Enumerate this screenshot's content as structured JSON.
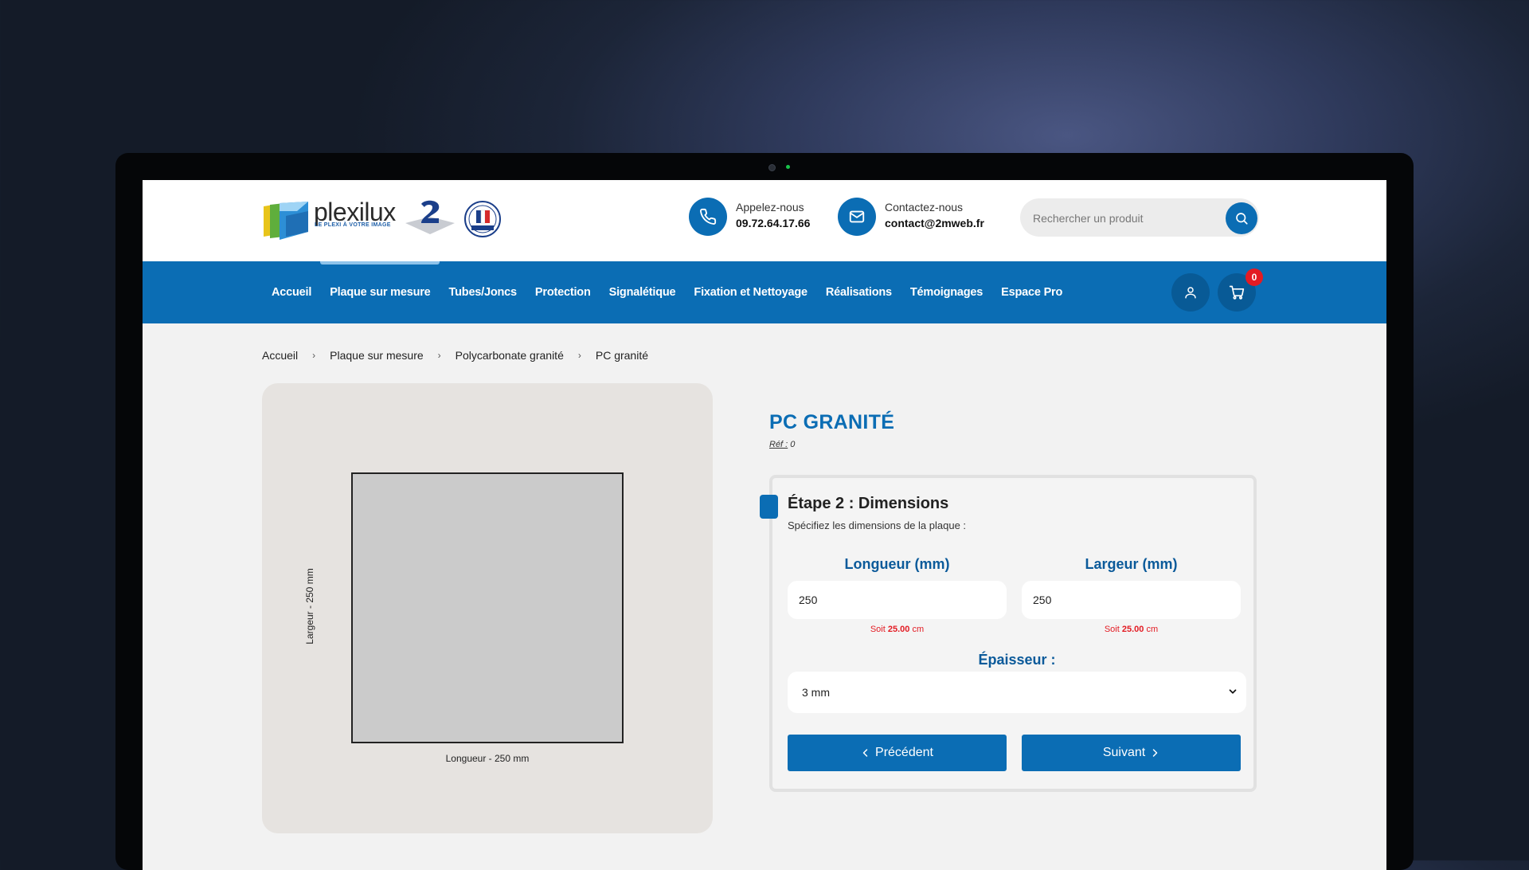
{
  "brand": {
    "name": "plexilux",
    "tagline": "LE PLEXI À VOTRE IMAGE",
    "accent_color": "#0b6db4"
  },
  "contact": {
    "phone_label": "Appelez-nous",
    "phone_value": "09.72.64.17.66",
    "email_label": "Contactez-nous",
    "email_value": "contact@2mweb.fr"
  },
  "search": {
    "placeholder": "Rechercher un produit"
  },
  "nav": {
    "items": [
      "Accueil",
      "Plaque sur mesure",
      "Tubes/Joncs",
      "Protection",
      "Signalétique",
      "Fixation et Nettoyage",
      "Réalisations",
      "Témoignages",
      "Espace Pro"
    ],
    "cart_count": "0"
  },
  "breadcrumb": [
    "Accueil",
    "Plaque sur mesure",
    "Polycarbonate granité",
    "PC granité"
  ],
  "preview": {
    "length_label": "Longueur - 250 mm",
    "width_label": "Largeur - 250 mm"
  },
  "product": {
    "title": "PC GRANITÉ",
    "ref_label": "Réf :",
    "ref_value": "0"
  },
  "step": {
    "title": "Étape 2 : Dimensions",
    "subtitle": "Spécifiez les dimensions de la plaque :",
    "length": {
      "label": "Longueur (mm)",
      "value": "250",
      "soit_prefix": "Soit",
      "soit_value": "25.00",
      "soit_unit": "cm"
    },
    "width": {
      "label": "Largeur (mm)",
      "value": "250",
      "soit_prefix": "Soit",
      "soit_value": "25.00",
      "soit_unit": "cm"
    },
    "thickness": {
      "label": "Épaisseur :",
      "value": "3 mm"
    },
    "prev_label": "Précédent",
    "next_label": "Suivant"
  }
}
